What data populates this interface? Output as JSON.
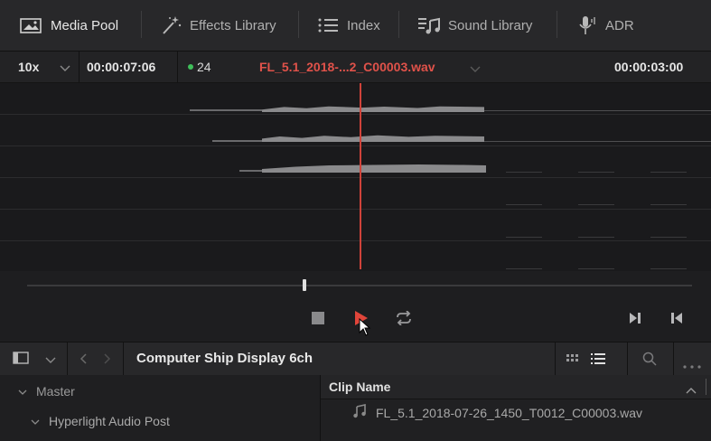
{
  "tabs": [
    {
      "label": "Media Pool",
      "icon": "media-pool-icon",
      "active": true
    },
    {
      "label": "Effects Library",
      "icon": "magic-wand-icon",
      "active": false
    },
    {
      "label": "Index",
      "icon": "list-icon",
      "active": false
    },
    {
      "label": "Sound Library",
      "icon": "music-note-icon",
      "active": false
    },
    {
      "label": "ADR",
      "icon": "microphone-icon",
      "active": false
    }
  ],
  "viewer": {
    "zoom": "10x",
    "timecode_left": "00:00:07:06",
    "channel_count": "24",
    "clip_title": "FL_5.1_2018-...2_C00003.wav",
    "timecode_right": "00:00:03:00",
    "playhead_color": "#d0433a",
    "clip_title_color": "#e0524a"
  },
  "transport": {
    "stop": "stop-icon",
    "play": "play-icon",
    "loop": "loop-icon",
    "next": "skip-to-end-icon",
    "prev": "skip-to-start-icon"
  },
  "pool": {
    "bin_title": "Computer Ship Display 6ch",
    "tree": [
      {
        "label": "Master"
      },
      {
        "label": "Hyperlight Audio Post"
      }
    ],
    "column_header": "Clip Name",
    "clips": [
      {
        "name": "FL_5.1_2018-07-26_1450_T0012_C00003.wav",
        "icon": "music-note-icon"
      }
    ]
  }
}
